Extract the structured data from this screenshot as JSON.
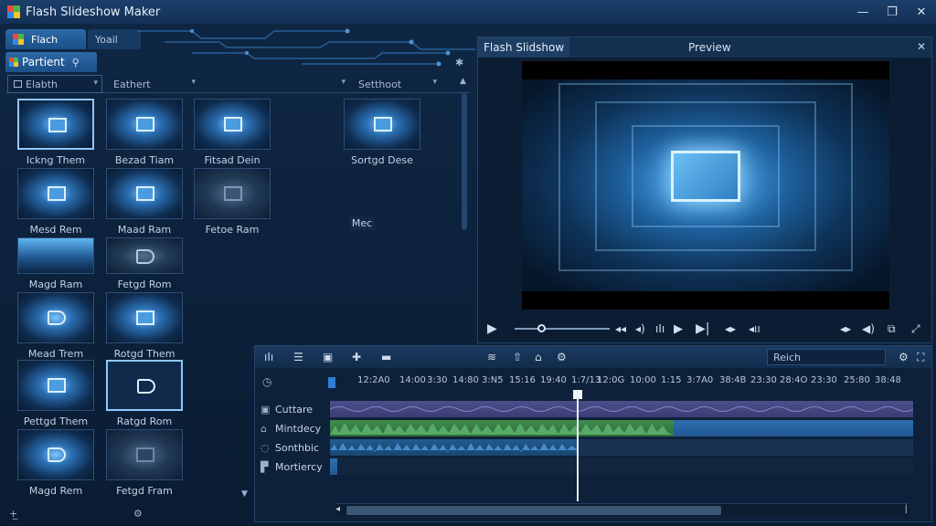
{
  "window": {
    "title": "Flash Slideshow Maker",
    "controls": [
      "—",
      "❐",
      "✕"
    ]
  },
  "left": {
    "tabs": [
      {
        "label": "Flach"
      },
      {
        "label": "Yoail"
      }
    ],
    "panel_title": "Partient",
    "filters": [
      "Elabth",
      "Eathert",
      "",
      "Setthoot"
    ],
    "thumbs": [
      {
        "caption": "Ickng Them"
      },
      {
        "caption": "Bezad Tiam"
      },
      {
        "caption": "Fitsad Dein"
      },
      {
        "caption": "Sortgd Dese"
      },
      {
        "caption": "Mesd Rem"
      },
      {
        "caption": "Maad Ram"
      },
      {
        "caption": "Fetoe Ram"
      },
      {
        "caption": "Mec"
      },
      {
        "caption": "Magd Ram"
      },
      {
        "caption": "Fetgd Rom"
      },
      {
        "caption": "Mead Trem"
      },
      {
        "caption": "Rotgd Them"
      },
      {
        "caption": "Pettgd Them"
      },
      {
        "caption": "Ratgd Rom"
      },
      {
        "caption": "Magd Rem"
      },
      {
        "caption": "Fetgd Fram"
      }
    ]
  },
  "preview": {
    "tab": "Flash Slidshow",
    "title": "Preview",
    "close": "✕"
  },
  "timeline": {
    "search_placeholder": "Reich",
    "ruler": [
      "12:2A0",
      "14:00",
      "3:30",
      "14:80",
      "3:N5",
      "15:16",
      "19:40",
      "1:7/13",
      "12:0G",
      "10:00",
      "1:15",
      "3:7A0",
      "38:4B",
      "23:30",
      "28:4O",
      "23:30",
      "25:80",
      "38:48"
    ],
    "tracks": [
      {
        "label": "Cuttare",
        "icon": "image-track-icon"
      },
      {
        "label": "Mintdecy",
        "icon": "video-track-icon"
      },
      {
        "label": "Sonthbic",
        "icon": "audio-track-icon"
      },
      {
        "label": "Mortiercy",
        "icon": "text-track-icon"
      }
    ]
  },
  "colors": {
    "accent": "#2d6aa8",
    "purple_clip": "#4d4f8c",
    "green_clip": "#3f8c4e",
    "blue_clip": "#2d6fb0"
  }
}
